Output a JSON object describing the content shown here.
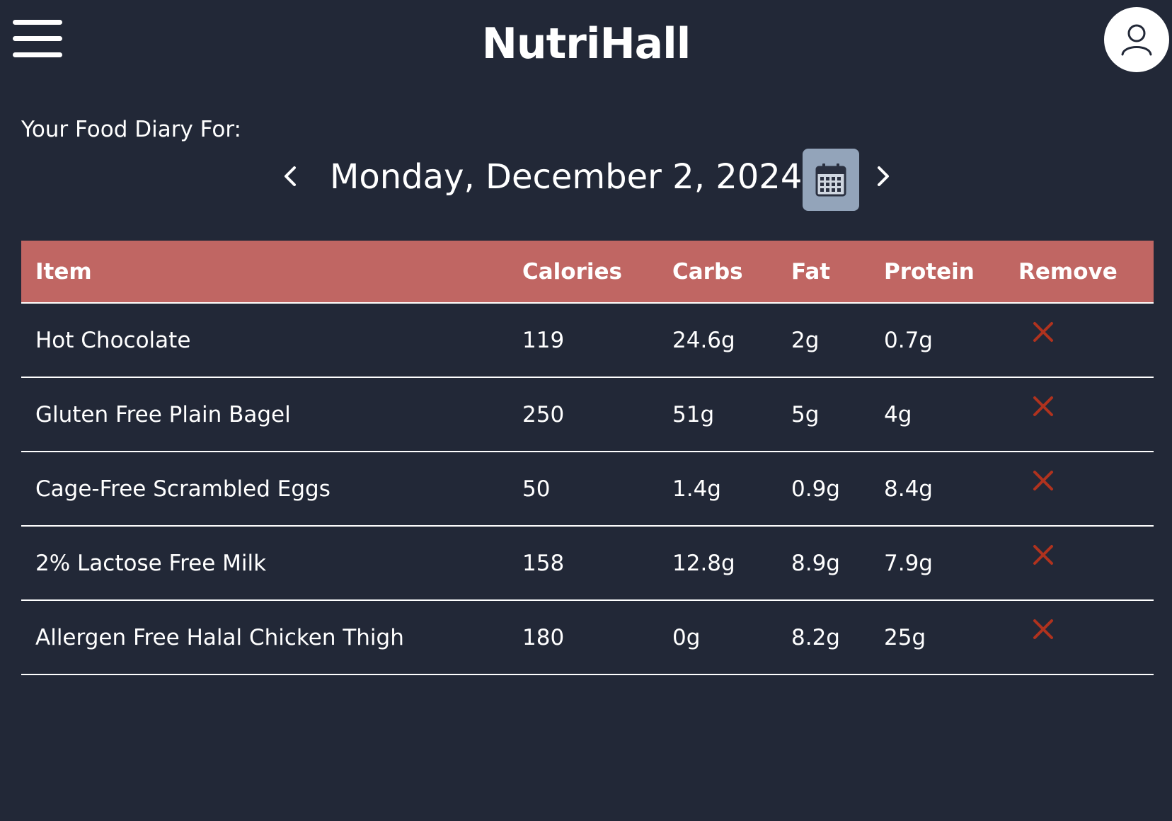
{
  "header": {
    "title": "NutriHall",
    "menu_icon": "hamburger-menu-icon",
    "profile_icon": "user-icon"
  },
  "diary": {
    "label": "Your Food Diary For:",
    "date": "Monday, December 2, 2024",
    "prev_icon": "chevron-left-icon",
    "next_icon": "chevron-right-icon",
    "calendar_icon": "calendar-icon"
  },
  "table": {
    "columns": [
      "Item",
      "Calories",
      "Carbs",
      "Fat",
      "Protein",
      "Remove"
    ],
    "rows": [
      {
        "item": "Hot Chocolate",
        "calories": "119",
        "carbs": "24.6g",
        "fat": "2g",
        "protein": "0.7g"
      },
      {
        "item": "Gluten Free Plain Bagel",
        "calories": "250",
        "carbs": "51g",
        "fat": "5g",
        "protein": "4g"
      },
      {
        "item": "Cage-Free Scrambled Eggs",
        "calories": "50",
        "carbs": "1.4g",
        "fat": "0.9g",
        "protein": "8.4g"
      },
      {
        "item": "2% Lactose Free Milk",
        "calories": "158",
        "carbs": "12.8g",
        "fat": "8.9g",
        "protein": "7.9g"
      },
      {
        "item": "Allergen Free Halal Chicken Thigh",
        "calories": "180",
        "carbs": "0g",
        "fat": "8.2g",
        "protein": "25g"
      }
    ],
    "remove_icon": "close-icon"
  },
  "colors": {
    "background": "#222837",
    "table_header": "#c06663",
    "calendar_button": "#93a4ba",
    "remove_icon": "#b0321e"
  }
}
